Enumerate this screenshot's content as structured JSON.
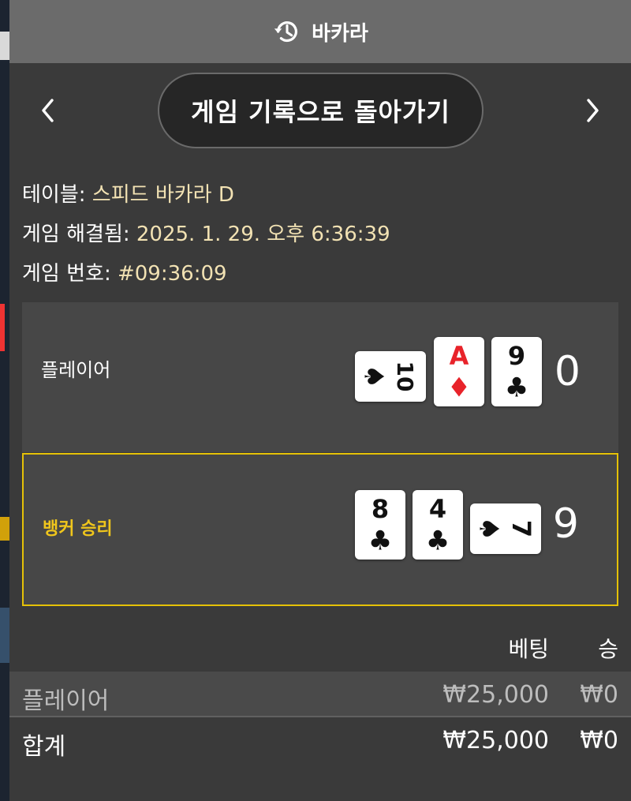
{
  "header": {
    "title": "바카라",
    "icon": "history-icon"
  },
  "nav": {
    "back_label": "게임 기록으로 돌아가기",
    "prev_icon": "chevron-left-icon",
    "next_icon": "chevron-right-icon"
  },
  "info": {
    "table_label": "테이블: ",
    "table_value": "스피드 바카라 D",
    "resolved_label": "게임 해결됨: ",
    "resolved_value": "2025. 1. 29. 오후 6:36:39",
    "number_label": "게임 번호: ",
    "number_value": "#09:36:09"
  },
  "player": {
    "label": "플레이어",
    "score": "0",
    "cards": [
      {
        "rank": "10",
        "suit": "♠",
        "suit_name": "spade",
        "color": "#111111",
        "orientation": "sideways"
      },
      {
        "rank": "A",
        "suit": "♦",
        "suit_name": "diamond",
        "color": "#e8232a",
        "orientation": "upright"
      },
      {
        "rank": "9",
        "suit": "♣",
        "suit_name": "club",
        "color": "#111111",
        "orientation": "upright"
      }
    ]
  },
  "banker": {
    "label": "뱅커 승리",
    "score": "9",
    "highlight_color": "#e5c107",
    "cards": [
      {
        "rank": "8",
        "suit": "♣",
        "suit_name": "club",
        "color": "#111111",
        "orientation": "upright"
      },
      {
        "rank": "4",
        "suit": "♣",
        "suit_name": "club",
        "color": "#111111",
        "orientation": "upright"
      },
      {
        "rank": "7",
        "suit": "♠",
        "suit_name": "spade",
        "color": "#111111",
        "orientation": "sideways"
      }
    ]
  },
  "bets": {
    "col_bet": "베팅",
    "col_win": "승",
    "rows": [
      {
        "name": "플레이어",
        "amount": "₩25,000",
        "win": "₩0"
      }
    ],
    "total": {
      "name": "합계",
      "amount": "₩25,000",
      "win": "₩0"
    }
  }
}
